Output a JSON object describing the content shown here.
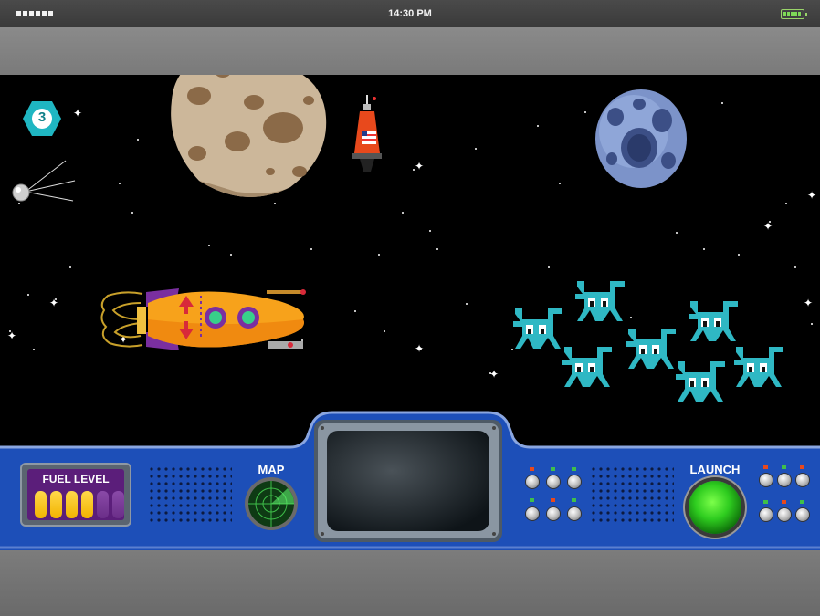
{
  "status_bar": {
    "time": "14:30 PM"
  },
  "game": {
    "level": "3",
    "colors": {
      "space": "#000000",
      "console": "#1d4fb8",
      "fuel_panel": "#5b1e7a",
      "alien": "#2fb8c4",
      "rocket": "#f7a21b",
      "launch": "#2ecc1f"
    }
  },
  "console": {
    "fuel_label": "FUEL LEVEL",
    "fuel_cells_total": 6,
    "fuel_cells_filled": 4,
    "map_label": "MAP",
    "launch_label": "LAUNCH"
  },
  "icons": [
    "level-badge-icon",
    "satellite-icon",
    "planet-icon",
    "capsule-icon",
    "moon-icon",
    "rocket-icon",
    "alien-icon",
    "radar-icon",
    "screen-icon",
    "launch-button-icon"
  ]
}
